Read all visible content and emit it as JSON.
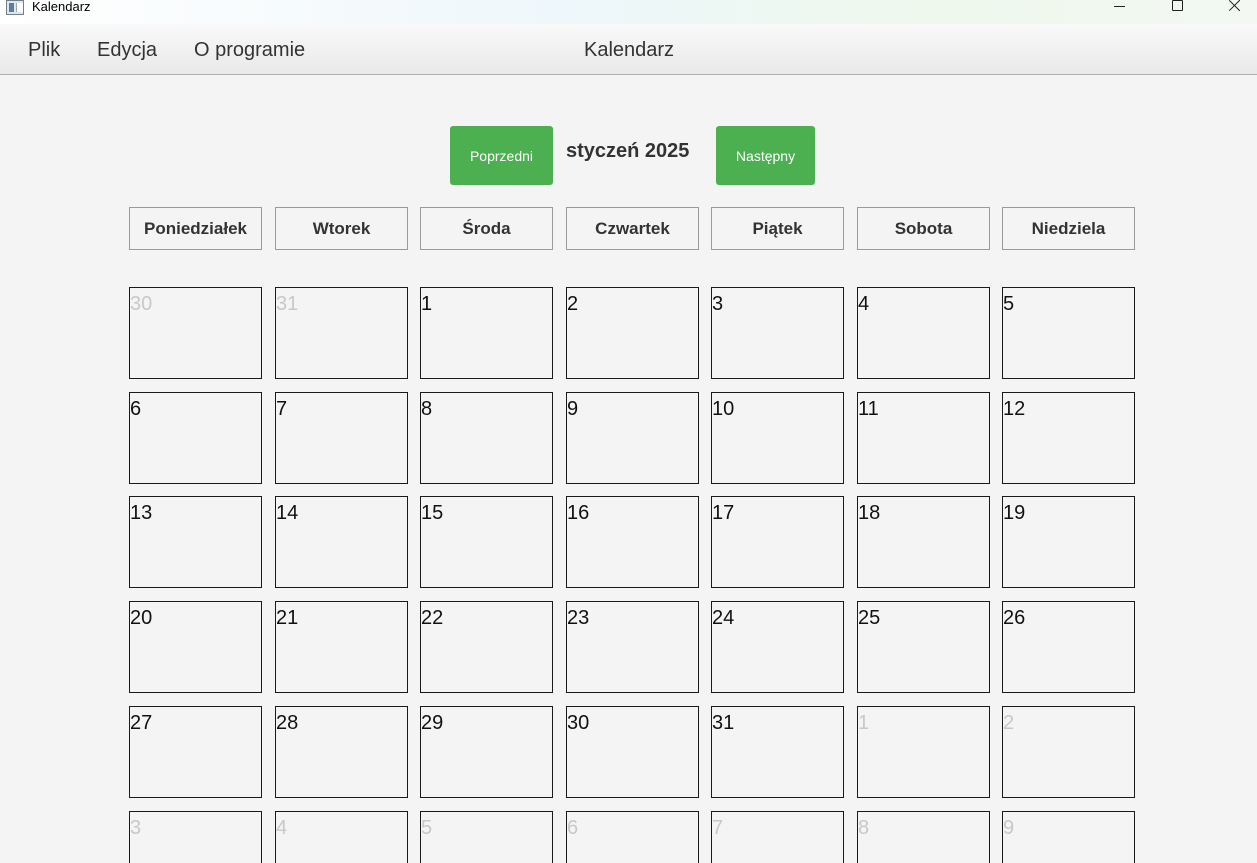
{
  "window": {
    "title": "Kalendarz"
  },
  "menu": {
    "items": [
      "Plik",
      "Edycja",
      "O programie"
    ],
    "title": "Kalendarz"
  },
  "navigation": {
    "prev_label": "Poprzedni",
    "month_label": "styczeń 2025",
    "next_label": "Następny",
    "button_color": "#4cb050"
  },
  "weekdays": [
    "Poniedziałek",
    "Wtorek",
    "Środa",
    "Czwartek",
    "Piątek",
    "Sobota",
    "Niedziela"
  ],
  "weeks": [
    [
      {
        "day": "30",
        "other": true
      },
      {
        "day": "31",
        "other": true
      },
      {
        "day": "1",
        "other": false
      },
      {
        "day": "2",
        "other": false
      },
      {
        "day": "3",
        "other": false
      },
      {
        "day": "4",
        "other": false
      },
      {
        "day": "5",
        "other": false
      }
    ],
    [
      {
        "day": "6",
        "other": false
      },
      {
        "day": "7",
        "other": false
      },
      {
        "day": "8",
        "other": false
      },
      {
        "day": "9",
        "other": false
      },
      {
        "day": "10",
        "other": false
      },
      {
        "day": "11",
        "other": false
      },
      {
        "day": "12",
        "other": false
      }
    ],
    [
      {
        "day": "13",
        "other": false
      },
      {
        "day": "14",
        "other": false
      },
      {
        "day": "15",
        "other": false
      },
      {
        "day": "16",
        "other": false
      },
      {
        "day": "17",
        "other": false
      },
      {
        "day": "18",
        "other": false
      },
      {
        "day": "19",
        "other": false
      }
    ],
    [
      {
        "day": "20",
        "other": false
      },
      {
        "day": "21",
        "other": false
      },
      {
        "day": "22",
        "other": false
      },
      {
        "day": "23",
        "other": false
      },
      {
        "day": "24",
        "other": false
      },
      {
        "day": "25",
        "other": false
      },
      {
        "day": "26",
        "other": false
      }
    ],
    [
      {
        "day": "27",
        "other": false
      },
      {
        "day": "28",
        "other": false
      },
      {
        "day": "29",
        "other": false
      },
      {
        "day": "30",
        "other": false
      },
      {
        "day": "31",
        "other": false
      },
      {
        "day": "1",
        "other": true
      },
      {
        "day": "2",
        "other": true
      }
    ],
    [
      {
        "day": "3",
        "other": true
      },
      {
        "day": "4",
        "other": true
      },
      {
        "day": "5",
        "other": true
      },
      {
        "day": "6",
        "other": true
      },
      {
        "day": "7",
        "other": true
      },
      {
        "day": "8",
        "other": true
      },
      {
        "day": "9",
        "other": true
      }
    ]
  ]
}
